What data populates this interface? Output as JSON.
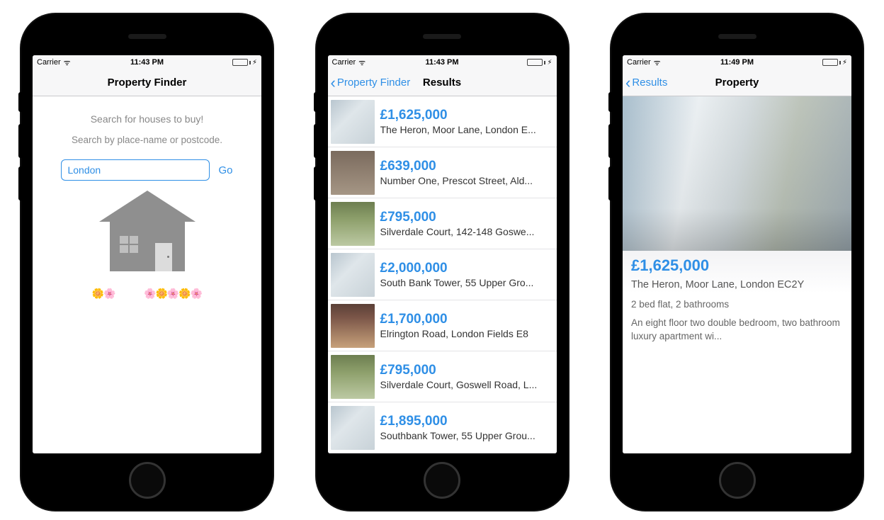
{
  "statusbar": {
    "carrier": "Carrier",
    "time1": "11:43 PM",
    "time2": "11:43 PM",
    "time3": "11:49 PM",
    "wifi_glyph": "ᯤ",
    "bolt_glyph": "⚡︎"
  },
  "colors": {
    "accent": "#2f8fe6",
    "battery_fill": "#3ecf3e"
  },
  "screen1": {
    "nav_title": "Property Finder",
    "heading": "Search for houses to buy!",
    "subheading": "Search by place-name or postcode.",
    "input_value": "London",
    "go_label": "Go"
  },
  "screen2": {
    "back_label": "Property Finder",
    "nav_title": "Results",
    "results": [
      {
        "price": "£1,625,000",
        "address": "The Heron, Moor Lane, London E..."
      },
      {
        "price": "£639,000",
        "address": "Number One, Prescot Street, Ald..."
      },
      {
        "price": "£795,000",
        "address": "Silverdale Court, 142-148 Goswe..."
      },
      {
        "price": "£2,000,000",
        "address": "South Bank Tower, 55 Upper Gro..."
      },
      {
        "price": "£1,700,000",
        "address": "Elrington Road, London Fields E8"
      },
      {
        "price": "£795,000",
        "address": "Silverdale Court, Goswell Road, L..."
      },
      {
        "price": "£1,895,000",
        "address": "Southbank Tower, 55 Upper Grou..."
      }
    ]
  },
  "screen3": {
    "back_label": "Results",
    "nav_title": "Property",
    "price": "£1,625,000",
    "address": "The Heron, Moor Lane, London EC2Y",
    "meta": "2 bed flat, 2 bathrooms",
    "description": "An eight floor two double bedroom, two bathroom luxury apartment wi..."
  }
}
